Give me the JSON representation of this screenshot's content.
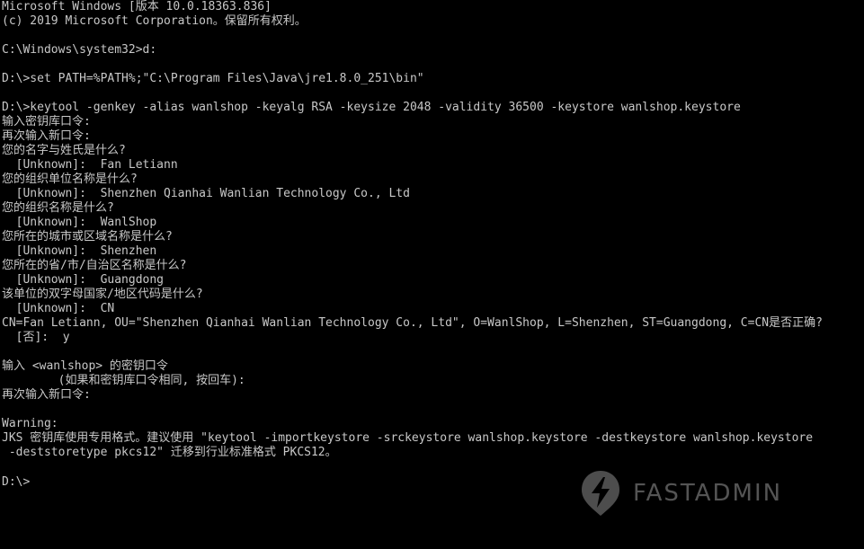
{
  "terminal": {
    "lines": [
      "Microsoft Windows [版本 10.0.18363.836]",
      "(c) 2019 Microsoft Corporation。保留所有权利。",
      "",
      "C:\\Windows\\system32>d:",
      "",
      "D:\\>set PATH=%PATH%;\"C:\\Program Files\\Java\\jre1.8.0_251\\bin\"",
      "",
      "D:\\>keytool -genkey -alias wanlshop -keyalg RSA -keysize 2048 -validity 36500 -keystore wanlshop.keystore",
      "输入密钥库口令:",
      "再次输入新口令:",
      "您的名字与姓氏是什么?",
      "  [Unknown]:  Fan Letiann",
      "您的组织单位名称是什么?",
      "  [Unknown]:  Shenzhen Qianhai Wanlian Technology Co., Ltd",
      "您的组织名称是什么?",
      "  [Unknown]:  WanlShop",
      "您所在的城市或区域名称是什么?",
      "  [Unknown]:  Shenzhen",
      "您所在的省/市/自治区名称是什么?",
      "  [Unknown]:  Guangdong",
      "该单位的双字母国家/地区代码是什么?",
      "  [Unknown]:  CN",
      "CN=Fan Letiann, OU=\"Shenzhen Qianhai Wanlian Technology Co., Ltd\", O=WanlShop, L=Shenzhen, ST=Guangdong, C=CN是否正确?",
      "  [否]:  y",
      "",
      "输入 <wanlshop> 的密钥口令",
      "        (如果和密钥库口令相同, 按回车):",
      "再次输入新口令:",
      "",
      "Warning:",
      "JKS 密钥库使用专用格式。建议使用 \"keytool -importkeystore -srckeystore wanlshop.keystore -destkeystore wanlshop.keystore",
      " -deststoretype pkcs12\" 迁移到行业标准格式 PKCS12。",
      "",
      "D:\\>"
    ]
  },
  "watermark": {
    "text": "FASTADMIN",
    "icon": "fastadmin-logo-icon"
  },
  "colors": {
    "background": "#000000",
    "text": "#c8c8c8",
    "watermark": "#9a9a9a"
  }
}
